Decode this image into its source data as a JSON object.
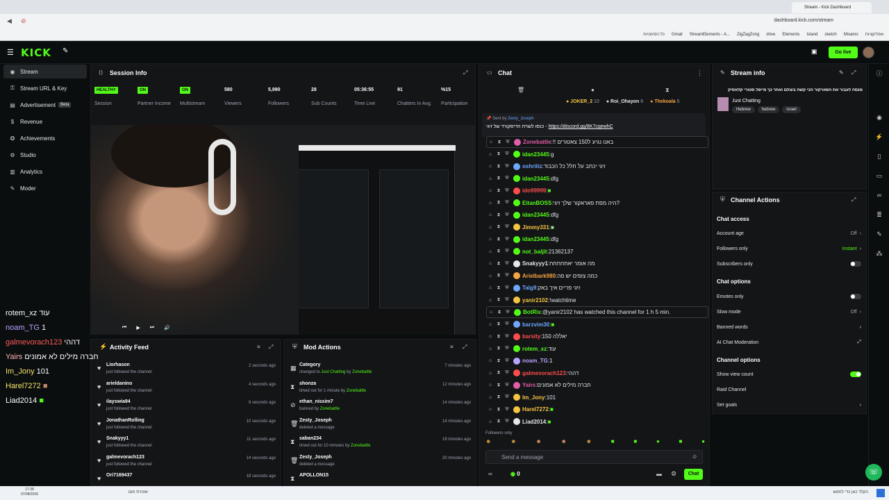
{
  "browser": {
    "tab_title": "Stream - Kick Dashboard",
    "url": "dashboard.kick.com/stream",
    "bookmarks": [
      "אפליקציות",
      "Gmail",
      "StreamElements - A...",
      "ZigZagZong",
      "drive",
      "Elements",
      "Island",
      "sketch",
      "Mixamo",
      "כל הסימניות"
    ]
  },
  "header": {
    "logo": "KICK",
    "go_live": "Go live"
  },
  "sidebar": {
    "items": [
      {
        "label": "Stream",
        "icon": "stream-icon"
      },
      {
        "label": "Stream URL & Key",
        "icon": "key-icon"
      },
      {
        "label": "Advertisement",
        "icon": "ad-icon",
        "badge": "Beta"
      },
      {
        "label": "Revenue",
        "icon": "dollar-icon"
      },
      {
        "label": "Achievements",
        "icon": "trophy-icon"
      },
      {
        "label": "Studio",
        "icon": "studio-icon"
      },
      {
        "label": "Analytics",
        "icon": "chart-icon"
      },
      {
        "label": "Moder",
        "icon": "wrench-icon"
      }
    ]
  },
  "session": {
    "title": "Session Info",
    "stats": [
      {
        "value": "HEALTHY",
        "label": "Session",
        "badge": true
      },
      {
        "value": "ON",
        "label": "Partner Income",
        "badge": true
      },
      {
        "value": "ON",
        "label": "Multistream",
        "badge": true
      },
      {
        "value": "580",
        "label": "Viewers"
      },
      {
        "value": "5,990",
        "label": "Followers"
      },
      {
        "value": "28",
        "label": "Sub Counts"
      },
      {
        "value": "05:36:55",
        "label": "Time Live"
      },
      {
        "value": "91",
        "label": "Chatters In Avg."
      },
      {
        "value": "%15",
        "label": "Participation"
      }
    ]
  },
  "overlay_chat": [
    {
      "user": "rotem_xz",
      "msg": "עוד",
      "color": "#ffffff"
    },
    {
      "user": "noam_TG",
      "msg": "1",
      "color": "#b9a3ff"
    },
    {
      "user": "galmevorach123",
      "msg": "הי‎דה",
      "color": "#ff5a5a"
    },
    {
      "user": "Yairs",
      "msg": "חברה מילים לא אמונים",
      "color": "#ffb3b3"
    },
    {
      "user": "Im_Jony",
      "msg": "101",
      "color": "#f5e56b"
    },
    {
      "user": "Harel7272",
      "msg": "",
      "color": "#f5e56b"
    },
    {
      "user": "Liad2014",
      "msg": "",
      "color": "#ffffff"
    }
  ],
  "activity": {
    "title": "Activity Feed",
    "rows": [
      {
        "name": "Liorhason",
        "sub": "just followed the channel",
        "time": "2 seconds ago"
      },
      {
        "name": "arieldanino",
        "sub": "just followed the channel",
        "time": "4 seconds ago"
      },
      {
        "name": "ilayswia94",
        "sub": "just followed the channel",
        "time": "8 seconds ago"
      },
      {
        "name": "JonathanRolling",
        "sub": "just followed the channel",
        "time": "10 seconds ago"
      },
      {
        "name": "Snakyyy1",
        "sub": "just followed the channel",
        "time": "11 seconds ago"
      },
      {
        "name": "galmevorach123",
        "sub": "just followed the channel",
        "time": "14 seconds ago"
      },
      {
        "name": "Ori7169437",
        "sub": "",
        "time": "18 seconds ago"
      }
    ]
  },
  "mod": {
    "title": "Mod Actions",
    "rows": [
      {
        "name": "Category",
        "sub": "changed to ",
        "hl": "Just Chatting",
        "sub2": " by ",
        "by": "Zonebattle",
        "time": "7 minutes ago",
        "icon": "calendar-icon"
      },
      {
        "name": "shonza",
        "sub": "timed out for 1 minute by ",
        "hl": "",
        "sub2": "",
        "by": "Zonebattle",
        "time": "12 minutes ago",
        "icon": "hourglass-icon"
      },
      {
        "name": "ethan_nissim7",
        "sub": "banned by ",
        "hl": "",
        "sub2": "",
        "by": "Zonebattle",
        "time": "14 minutes ago",
        "icon": "ban-icon"
      },
      {
        "name": "Zesty_Joseph",
        "sub": "deleted a message",
        "hl": "",
        "sub2": "",
        "by": "",
        "time": "14 minutes ago",
        "icon": "trash-icon"
      },
      {
        "name": "saban234",
        "sub": "timed out for 10 minutes by ",
        "hl": "",
        "sub2": "",
        "by": "Zonebattle",
        "time": "19 minutes ago",
        "icon": "hourglass-icon"
      },
      {
        "name": "Zesty_Joseph",
        "sub": "deleted a message",
        "hl": "",
        "sub2": "",
        "by": "",
        "time": "20 minutes ago",
        "icon": "trash-icon"
      },
      {
        "name": "APOLLON15",
        "sub": "",
        "hl": "",
        "sub2": "",
        "by": "",
        "time": "",
        "icon": "hourglass-icon"
      }
    ]
  },
  "chat": {
    "title": "Chat",
    "top": [
      {
        "name": "JOKER_2",
        "count": "10",
        "color": "#f5c542"
      },
      {
        "name": "Roi_Ohayon",
        "count": "6",
        "color": "#e5e7eb"
      },
      {
        "name": "Thekoala",
        "count": "5",
        "color": "#f5a442"
      }
    ],
    "pinned_by_label": "Sent by",
    "pinned_by": "Zesty_Joseph",
    "pinned_msg": "כנסו לשרת הדיסקורד של זיגי - ",
    "pinned_link": "https://discord.gg/8K7cqewhC",
    "messages": [
      {
        "user": "Zonebattle",
        "msg": "!! באנו נגיע ל150 צאטורים",
        "color": "#e05da8"
      },
      {
        "user": "idan23445",
        "msg": "g",
        "color": "#53fc18"
      },
      {
        "user": "oshriitz",
        "msg": "זיגי יכתב על חלל כל הכבוד",
        "color": "#6ea8ff"
      },
      {
        "user": "idan23445",
        "msg": "dfg",
        "color": "#53fc18"
      },
      {
        "user": "ido99999",
        "msg": "",
        "color": "#ff4d4d"
      },
      {
        "user": "EitanBOSS",
        "msg": "היה מפת פאראקור שלך זיגי?",
        "color": "#53fc18"
      },
      {
        "user": "idan23445",
        "msg": "dfg",
        "color": "#53fc18"
      },
      {
        "user": "Jimmy331",
        "msg": "",
        "color": "#f5c542"
      },
      {
        "user": "idan23445",
        "msg": "dfg",
        "color": "#53fc18"
      },
      {
        "user": "not_baljit",
        "msg": "21362137",
        "color": "#53fc18"
      },
      {
        "user": "Snakyyy1",
        "msg": "מה אומר יאחחחחח",
        "color": "#e5e7eb"
      },
      {
        "user": "Arielbark980",
        "msg": "כמה צופים יש פה",
        "color": "#f5a442"
      },
      {
        "user": "Talg9",
        "msg": "זיגי פריים איך באק",
        "color": "#6ea8ff"
      },
      {
        "user": "yanir2102",
        "msg": "!watchtime",
        "color": "#f5c542"
      },
      {
        "user": "BotRix",
        "msg": "@yanir2102 has watched this channel for 1 h 5 min.",
        "color": "#53fc18"
      },
      {
        "user": "barzvim30",
        "msg": "",
        "color": "#6ea8ff"
      },
      {
        "user": "barsity",
        "msg": "יאללה 150",
        "color": "#ff4d4d"
      },
      {
        "user": "rotem_xz",
        "msg": "עוד",
        "color": "#53fc18"
      },
      {
        "user": "noam_TG",
        "msg": "1",
        "color": "#b9a3ff"
      },
      {
        "user": "galmevorach123",
        "msg": "הי‎דה",
        "color": "#ff4d4d"
      },
      {
        "user": "Yairs",
        "msg": "חברה מילים לא אמונים",
        "color": "#e05da8"
      },
      {
        "user": "Im_Jony",
        "msg": "101",
        "color": "#f5c542"
      },
      {
        "user": "Harel7272",
        "msg": "",
        "color": "#f5c542"
      },
      {
        "user": "Liad2014",
        "msg": "",
        "color": "#e5e7eb"
      }
    ],
    "followers_only": "Followers only",
    "placeholder": "Send a message",
    "points": "0",
    "send": "Chat"
  },
  "stream_info": {
    "title": "Stream info",
    "stream_title": "מנסה לעבור את הפארקור הכי קשה בעולם ואחר כך מייפל סטורי קלאסיק",
    "category": "Just Chatting",
    "tags": [
      "Hebrew",
      "hebrew",
      "israel"
    ]
  },
  "channel_actions": {
    "title": "Channel Actions",
    "chat_access": "Chat access",
    "account_age": "Account age",
    "account_age_val": "Off",
    "followers_only": "Followers only",
    "followers_only_val": "Instant",
    "subscribers_only": "Subscribers only",
    "chat_options": "Chat options",
    "emotes_only": "Emotes only",
    "slow_mode": "Slow mode",
    "slow_mode_val": "Off",
    "banned_words": "Banned words",
    "ai_moderation": "AI Chat Moderation",
    "channel_options": "Channel options",
    "show_view_count": "Show view count",
    "raid_channel": "Raid Channel",
    "set_goals": "Set goals"
  },
  "taskbar": {
    "time": "17:38",
    "date": "07/08/2026",
    "search": "הקלד כאן כדי לחפש",
    "weather": "אזהרת חום"
  }
}
